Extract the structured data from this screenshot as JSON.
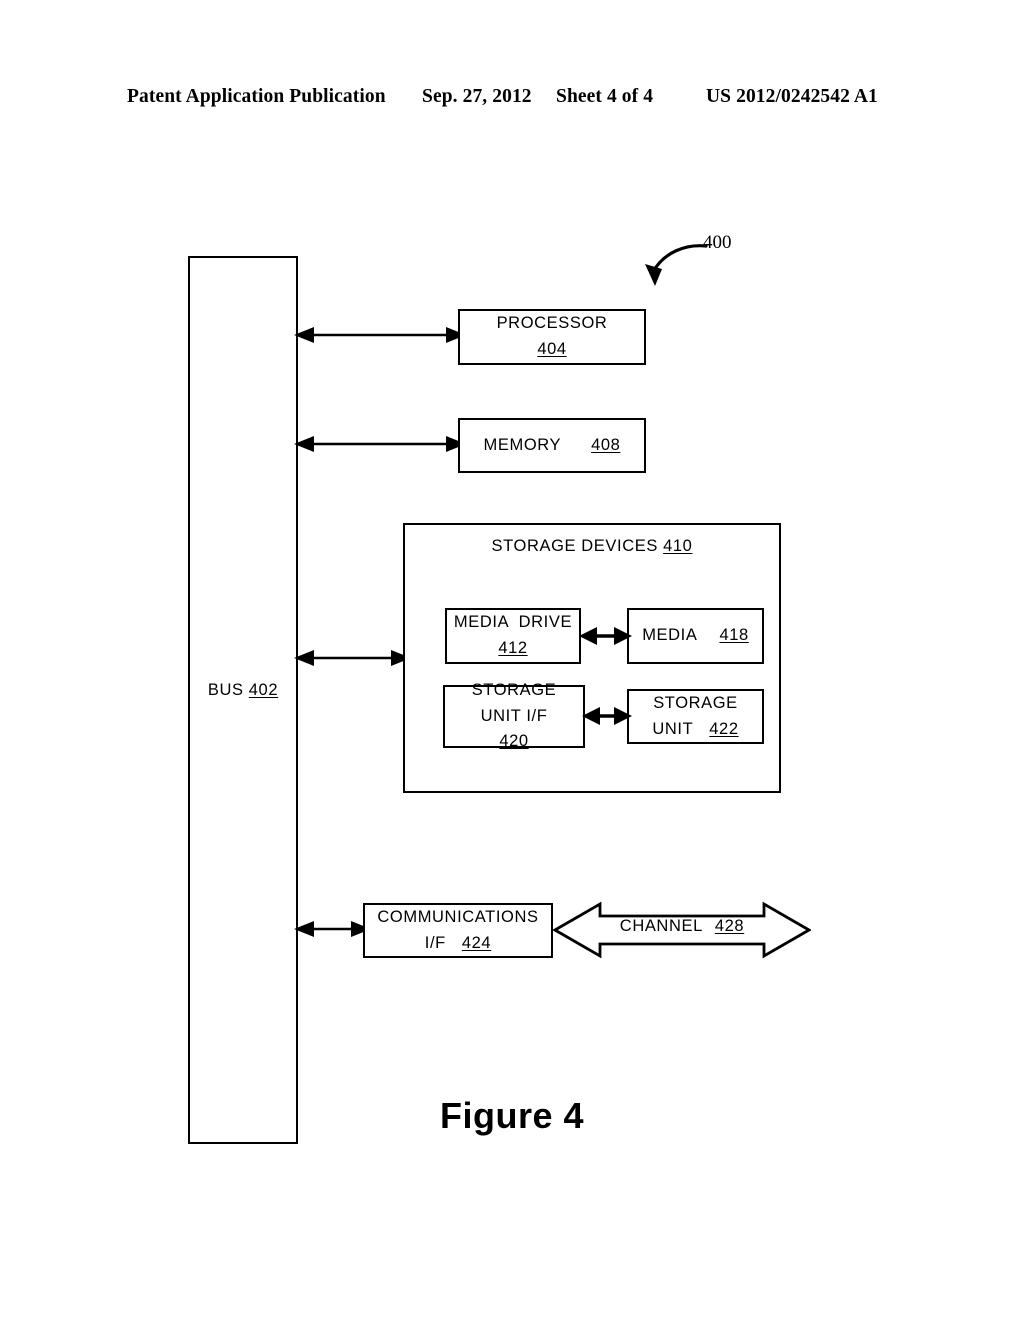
{
  "header": {
    "publication": "Patent Application Publication",
    "date": "Sep. 27, 2012",
    "sheet": "Sheet 4 of 4",
    "patent_number": "US 2012/0242542 A1"
  },
  "figure": {
    "caption": "Figure 4",
    "system_ref": "400"
  },
  "bus": {
    "label": "BUS",
    "ref": "402"
  },
  "blocks": {
    "processor": {
      "label": "PROCESSOR",
      "ref": "404"
    },
    "memory": {
      "label": "MEMORY",
      "ref": "408"
    },
    "storage_devices": {
      "label": "STORAGE DEVICES",
      "ref": "410"
    },
    "media_drive": {
      "label": "MEDIA  DRIVE",
      "ref": "412"
    },
    "media": {
      "label": "MEDIA",
      "ref": "418"
    },
    "storage_unit_if": {
      "line1": "STORAGE",
      "line2": "UNIT I/F",
      "ref": "420"
    },
    "storage_unit": {
      "line1": "STORAGE",
      "line2": "UNIT",
      "ref": "422"
    },
    "communications_if": {
      "line1": "COMMUNICATIONS",
      "line2": "I/F",
      "ref": "424"
    },
    "channel": {
      "label": "CHANNEL",
      "ref": "428"
    }
  },
  "colors": {
    "ink": "#000000",
    "paper": "#ffffff"
  }
}
